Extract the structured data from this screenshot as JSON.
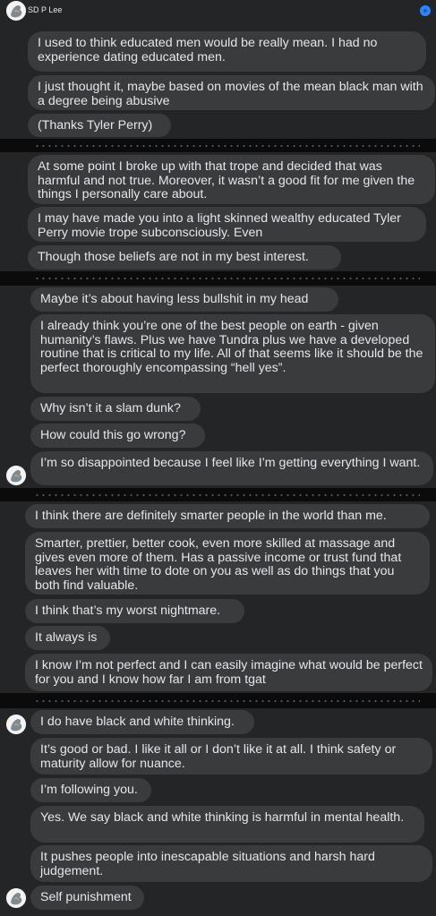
{
  "header": {
    "name": "SD P Lee"
  },
  "messages": {
    "m1": "I used to think educated men would be really mean. I had no experience dating educated men.",
    "m2": "I just thought it, maybe based on movies of the mean black man with a degree being abusive",
    "m3": "(Thanks Tyler Perry)",
    "m4": "At some point I broke up with that trope and decided that was harmful and not true. Moreover, it wasn’t a good fit for me given the things I personally care about.",
    "m5": "I may have made you into a light skinned wealthy educated Tyler Perry movie trope subconsciously.     Even",
    "m6": "Though those beliefs are not in my best interest.",
    "m7": "Maybe it’s about having less bullshit in my head",
    "m8": "I already think you’re one of the best people on earth - given humanity’s flaws. Plus we have Tundra plus we have a developed routine that is critical to my life.  All of that seems like it should be the perfect thoroughly encompassing “hell yes”.",
    "m9": "Why isn’t it a slam dunk?",
    "m10": "How could this go wrong?",
    "m11": "I’m so disappointed because I feel like I’m getting everything I want.",
    "m12": "I think there are definitely smarter people in the world than me.",
    "m13": "Smarter, prettier, better cook, even more skilled at massage and gives even more of them. Has a passive income or trust fund that leaves her with time to dote on you as well as do things that you both find valuable.",
    "m14": "I think that’s my worst nightmare.",
    "m15": "It always is",
    "m16": "I know I’m not perfect and I can easily imagine what would be perfect for you and I know how far I am from tgat",
    "m17": "I do have black and white thinking.",
    "m18": "It’s good or bad. I like it all or I don’t like it at all. I think safety or maturity allow for nuance.",
    "m19": "I’m following you.",
    "m20": "Yes. We say black and white thinking is harmful in mental health.",
    "m21": "It pushes people into inescapable situations and harsh hard judgement.",
    "m22": "Self punishment"
  },
  "colors": {
    "bubble": "#3a3b3c",
    "panel": "#242526",
    "accent": "#2d86ff"
  }
}
